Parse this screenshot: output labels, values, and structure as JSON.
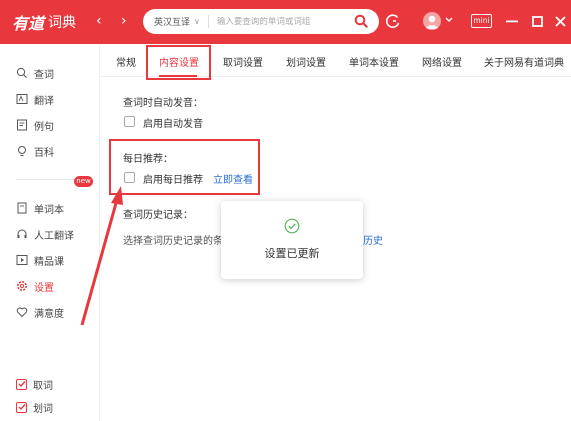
{
  "app": {
    "logo_brand": "有道",
    "logo_sub": "词典"
  },
  "titlebar": {
    "back_arrow": "‹",
    "forward_arrow": "›",
    "dict_select": "英汉互译",
    "search_placeholder": "输入要查询的单词或词组",
    "mini_label": "mini",
    "accent_color": "#e8383d"
  },
  "sidebar": {
    "items_top": [
      {
        "label": "查词",
        "icon": "magnifier-icon"
      },
      {
        "label": "翻译",
        "icon": "translate-icon"
      },
      {
        "label": "例句",
        "icon": "document-icon"
      },
      {
        "label": "百科",
        "icon": "lightbulb-icon"
      }
    ],
    "items_bottom": [
      {
        "label": "单词本",
        "icon": "wordbook-icon"
      },
      {
        "label": "人工翻译",
        "icon": "headset-icon"
      },
      {
        "label": "精品课",
        "icon": "play-icon"
      },
      {
        "label": "设置",
        "icon": "gear-icon"
      },
      {
        "label": "满意度",
        "icon": "heart-icon"
      }
    ],
    "new_badge": "new",
    "checks": [
      {
        "label": "取词",
        "checked": true
      },
      {
        "label": "划词",
        "checked": true
      }
    ]
  },
  "tabs": [
    "常规",
    "内容设置",
    "取词设置",
    "划词设置",
    "单词本设置",
    "网络设置",
    "关于网易有道词典"
  ],
  "content": {
    "auto_pron_title": "查词时自动发音：",
    "auto_pron_option": "启用自动发音",
    "daily_title": "每日推荐：",
    "daily_option": "启用每日推荐",
    "daily_link": "立即查看",
    "history_title": "查词历史记录：",
    "history_desc": "选择查词历史记录的条",
    "history_link": "历史"
  },
  "toast": {
    "message": "设置已更新"
  }
}
